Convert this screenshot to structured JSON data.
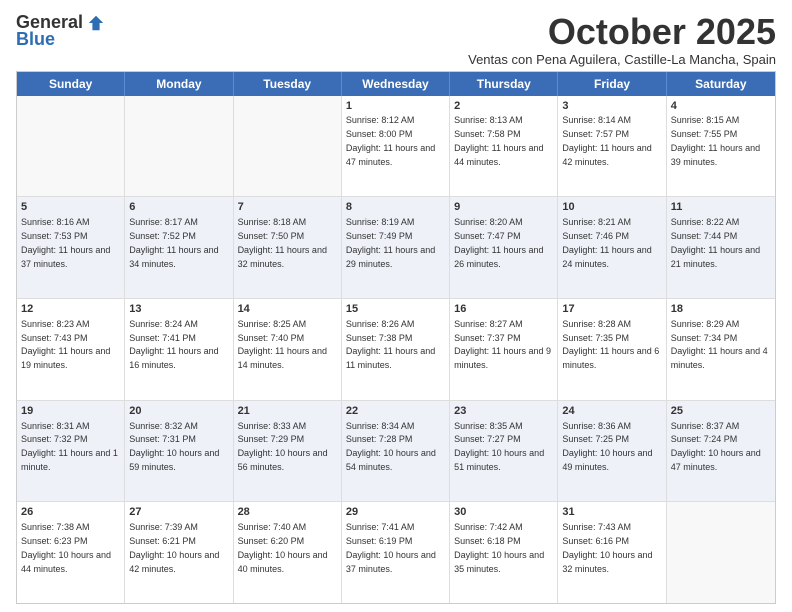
{
  "logo": {
    "general": "General",
    "blue": "Blue"
  },
  "title": "October 2025",
  "subtitle": "Ventas con Pena Aguilera, Castille-La Mancha, Spain",
  "weekdays": [
    "Sunday",
    "Monday",
    "Tuesday",
    "Wednesday",
    "Thursday",
    "Friday",
    "Saturday"
  ],
  "rows": [
    [
      {
        "day": "",
        "text": ""
      },
      {
        "day": "",
        "text": ""
      },
      {
        "day": "",
        "text": ""
      },
      {
        "day": "1",
        "text": "Sunrise: 8:12 AM\nSunset: 8:00 PM\nDaylight: 11 hours and 47 minutes."
      },
      {
        "day": "2",
        "text": "Sunrise: 8:13 AM\nSunset: 7:58 PM\nDaylight: 11 hours and 44 minutes."
      },
      {
        "day": "3",
        "text": "Sunrise: 8:14 AM\nSunset: 7:57 PM\nDaylight: 11 hours and 42 minutes."
      },
      {
        "day": "4",
        "text": "Sunrise: 8:15 AM\nSunset: 7:55 PM\nDaylight: 11 hours and 39 minutes."
      }
    ],
    [
      {
        "day": "5",
        "text": "Sunrise: 8:16 AM\nSunset: 7:53 PM\nDaylight: 11 hours and 37 minutes."
      },
      {
        "day": "6",
        "text": "Sunrise: 8:17 AM\nSunset: 7:52 PM\nDaylight: 11 hours and 34 minutes."
      },
      {
        "day": "7",
        "text": "Sunrise: 8:18 AM\nSunset: 7:50 PM\nDaylight: 11 hours and 32 minutes."
      },
      {
        "day": "8",
        "text": "Sunrise: 8:19 AM\nSunset: 7:49 PM\nDaylight: 11 hours and 29 minutes."
      },
      {
        "day": "9",
        "text": "Sunrise: 8:20 AM\nSunset: 7:47 PM\nDaylight: 11 hours and 26 minutes."
      },
      {
        "day": "10",
        "text": "Sunrise: 8:21 AM\nSunset: 7:46 PM\nDaylight: 11 hours and 24 minutes."
      },
      {
        "day": "11",
        "text": "Sunrise: 8:22 AM\nSunset: 7:44 PM\nDaylight: 11 hours and 21 minutes."
      }
    ],
    [
      {
        "day": "12",
        "text": "Sunrise: 8:23 AM\nSunset: 7:43 PM\nDaylight: 11 hours and 19 minutes."
      },
      {
        "day": "13",
        "text": "Sunrise: 8:24 AM\nSunset: 7:41 PM\nDaylight: 11 hours and 16 minutes."
      },
      {
        "day": "14",
        "text": "Sunrise: 8:25 AM\nSunset: 7:40 PM\nDaylight: 11 hours and 14 minutes."
      },
      {
        "day": "15",
        "text": "Sunrise: 8:26 AM\nSunset: 7:38 PM\nDaylight: 11 hours and 11 minutes."
      },
      {
        "day": "16",
        "text": "Sunrise: 8:27 AM\nSunset: 7:37 PM\nDaylight: 11 hours and 9 minutes."
      },
      {
        "day": "17",
        "text": "Sunrise: 8:28 AM\nSunset: 7:35 PM\nDaylight: 11 hours and 6 minutes."
      },
      {
        "day": "18",
        "text": "Sunrise: 8:29 AM\nSunset: 7:34 PM\nDaylight: 11 hours and 4 minutes."
      }
    ],
    [
      {
        "day": "19",
        "text": "Sunrise: 8:31 AM\nSunset: 7:32 PM\nDaylight: 11 hours and 1 minute."
      },
      {
        "day": "20",
        "text": "Sunrise: 8:32 AM\nSunset: 7:31 PM\nDaylight: 10 hours and 59 minutes."
      },
      {
        "day": "21",
        "text": "Sunrise: 8:33 AM\nSunset: 7:29 PM\nDaylight: 10 hours and 56 minutes."
      },
      {
        "day": "22",
        "text": "Sunrise: 8:34 AM\nSunset: 7:28 PM\nDaylight: 10 hours and 54 minutes."
      },
      {
        "day": "23",
        "text": "Sunrise: 8:35 AM\nSunset: 7:27 PM\nDaylight: 10 hours and 51 minutes."
      },
      {
        "day": "24",
        "text": "Sunrise: 8:36 AM\nSunset: 7:25 PM\nDaylight: 10 hours and 49 minutes."
      },
      {
        "day": "25",
        "text": "Sunrise: 8:37 AM\nSunset: 7:24 PM\nDaylight: 10 hours and 47 minutes."
      }
    ],
    [
      {
        "day": "26",
        "text": "Sunrise: 7:38 AM\nSunset: 6:23 PM\nDaylight: 10 hours and 44 minutes."
      },
      {
        "day": "27",
        "text": "Sunrise: 7:39 AM\nSunset: 6:21 PM\nDaylight: 10 hours and 42 minutes."
      },
      {
        "day": "28",
        "text": "Sunrise: 7:40 AM\nSunset: 6:20 PM\nDaylight: 10 hours and 40 minutes."
      },
      {
        "day": "29",
        "text": "Sunrise: 7:41 AM\nSunset: 6:19 PM\nDaylight: 10 hours and 37 minutes."
      },
      {
        "day": "30",
        "text": "Sunrise: 7:42 AM\nSunset: 6:18 PM\nDaylight: 10 hours and 35 minutes."
      },
      {
        "day": "31",
        "text": "Sunrise: 7:43 AM\nSunset: 6:16 PM\nDaylight: 10 hours and 32 minutes."
      },
      {
        "day": "",
        "text": ""
      }
    ]
  ]
}
